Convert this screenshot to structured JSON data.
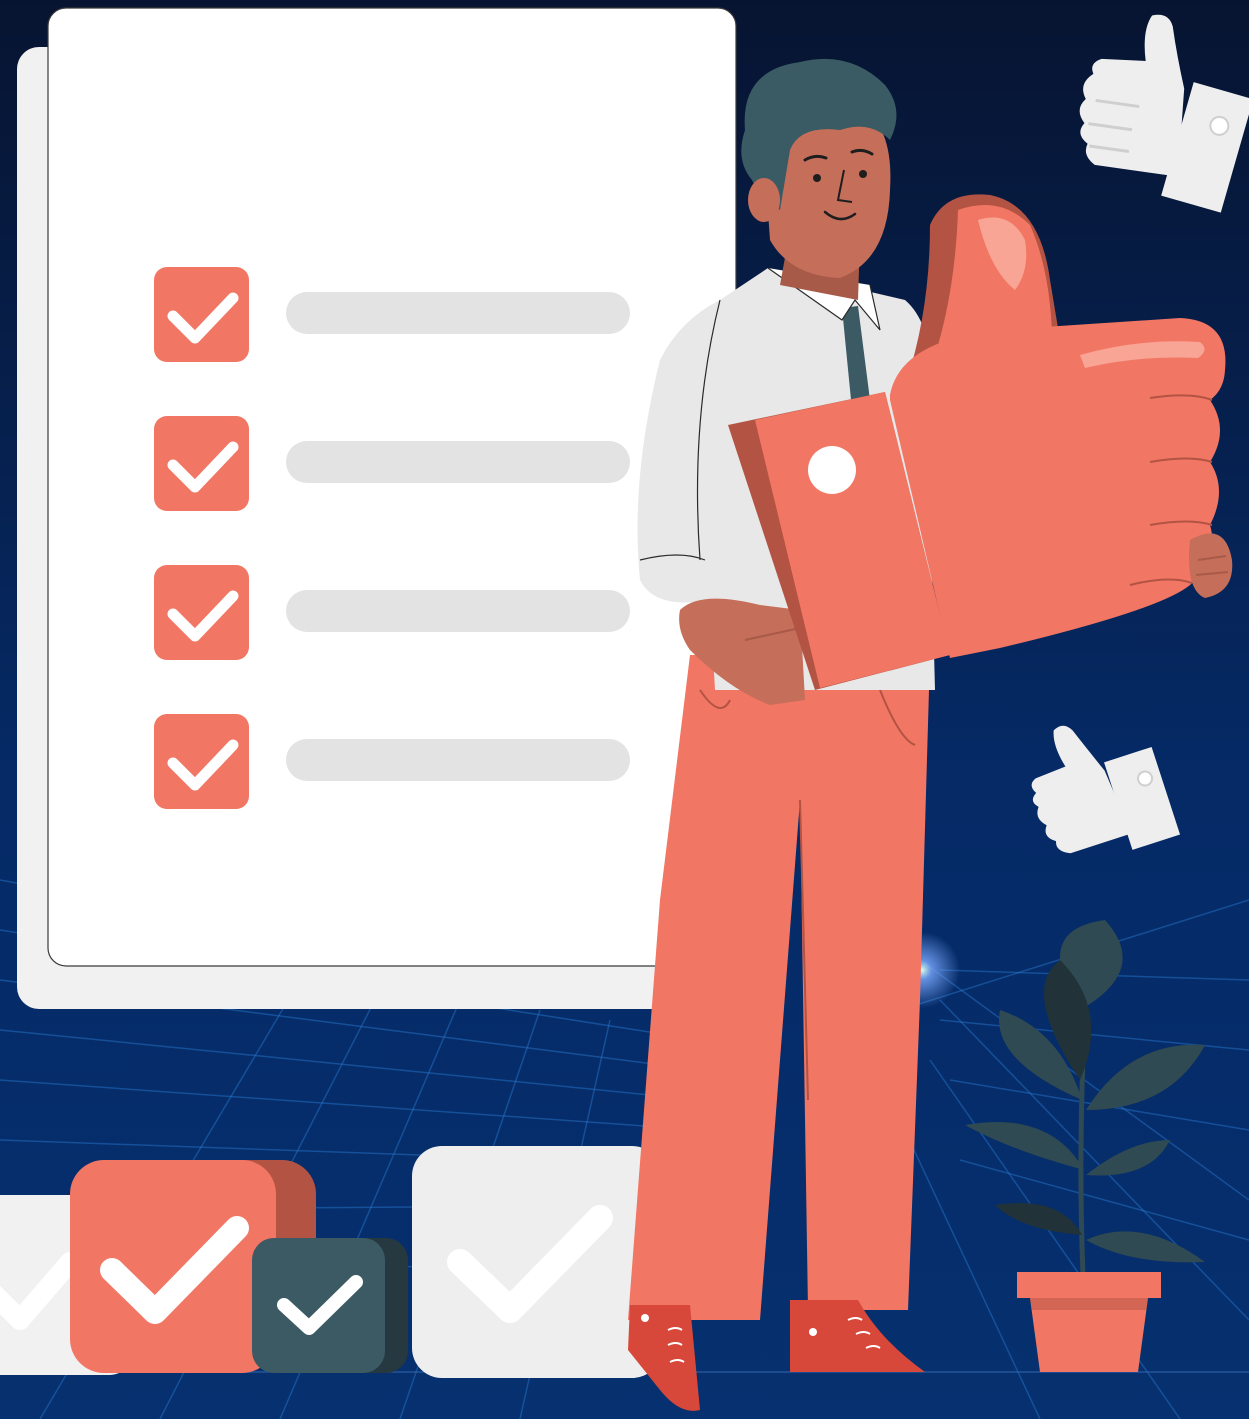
{
  "scene": {
    "background_colors": {
      "top": "#071431",
      "mid": "#052a66",
      "bottom": "#06306f",
      "grid_line": "#2a7bd1",
      "glow": "#7aa8ff"
    },
    "palette": {
      "coral": "#f27664",
      "coral_dark": "#b35343",
      "coral_light": "#f8a595",
      "paper": "#ffffff",
      "paper_back": "#f1f1f1",
      "line_placeholder": "#e3e3e3",
      "slate": "#3b5a64",
      "slate_dark": "#263840",
      "skin": "#c56e5a",
      "skin_dark": "#a85a48",
      "shirt": "#e8e8e8",
      "hair": "#3a5a64",
      "plant_leaf": "#2f4a52",
      "plant_leaf_dark": "#213338",
      "white_thumb": "#eeeeee"
    },
    "checklist": {
      "item_count": 4,
      "items_checked": [
        true,
        true,
        true,
        true
      ]
    },
    "floor_boxes": [
      {
        "kind": "white-check-box",
        "checked": true
      },
      {
        "kind": "coral-check-box",
        "checked": true
      },
      {
        "kind": "slate-check-box",
        "checked": true
      },
      {
        "kind": "white-check-box",
        "checked": true
      }
    ],
    "figures": [
      "person-thumbs-up",
      "big-thumbs-up-hand",
      "floating-thumb-top-right",
      "floating-thumb-right",
      "potted-plant"
    ],
    "icons": [
      "checkmark-icon",
      "thumbs-up-icon"
    ]
  }
}
